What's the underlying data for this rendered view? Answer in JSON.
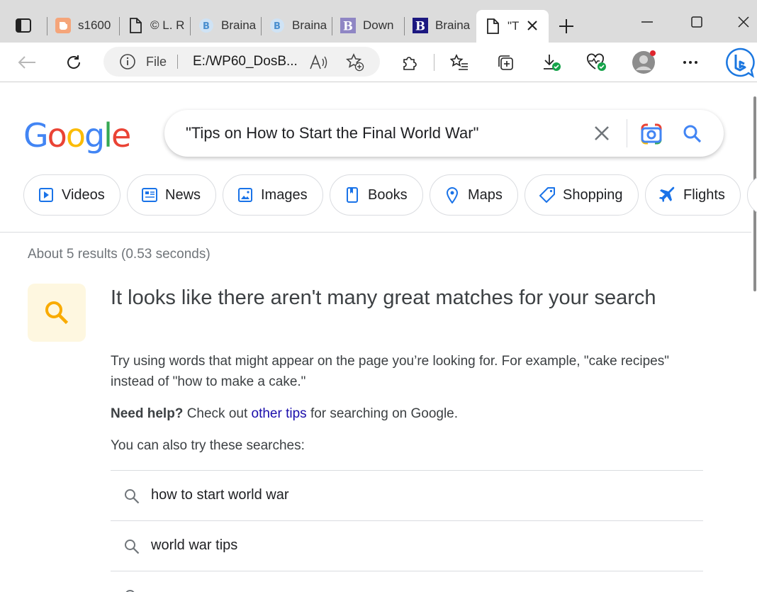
{
  "browser": {
    "tabs": [
      {
        "title": "s1600",
        "favicon": "blogger-icon"
      },
      {
        "title": "© L. R",
        "favicon": "page-icon"
      },
      {
        "title": "Braina",
        "favicon": "braina-b-icon"
      },
      {
        "title": "Braina",
        "favicon": "braina-b-icon"
      },
      {
        "title": "Down",
        "favicon": "braina-purple-b-icon"
      },
      {
        "title": "Braina",
        "favicon": "braina-navy-b-icon"
      },
      {
        "title": "\"T",
        "favicon": "page-icon",
        "active": true
      }
    ],
    "address": {
      "scheme_label": "File",
      "url": "E:/WP60_DosB..."
    }
  },
  "google": {
    "query": "\"Tips on How to Start the Final World War\"",
    "chips": [
      "Videos",
      "News",
      "Images",
      "Books",
      "Maps",
      "Shopping",
      "Flights"
    ],
    "stats": "About 5 results (0.53 seconds)",
    "headline": "It looks like there aren't many great matches for your search",
    "tip": "Try using words that might appear on the page you’re looking for. For example, \"cake recipes\" instead of \"how to make a cake.\"",
    "help_bold": "Need help?",
    "help_pre": "Check out",
    "help_link": "other tips",
    "help_post": "for searching on Google.",
    "also_try": "You can also try these searches:",
    "suggestions": [
      "how to start world war",
      "world war tips"
    ]
  },
  "colors": {
    "google_blue": "#4285f4",
    "google_red": "#ea4335",
    "google_yellow": "#fbbc05",
    "google_green": "#34a853",
    "link": "#1a0dab"
  }
}
